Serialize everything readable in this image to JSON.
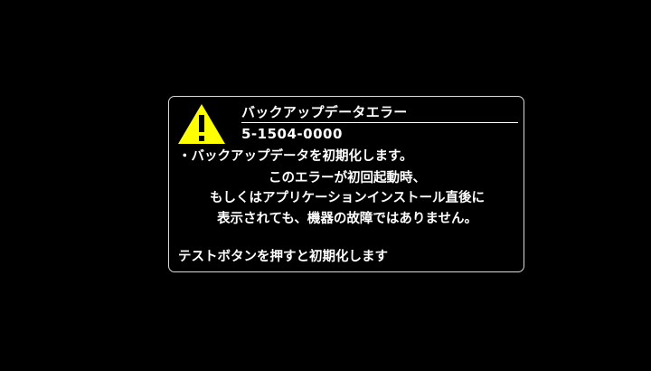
{
  "dialog": {
    "title": "バックアップデータエラー",
    "error_code": "5-1504-0000",
    "message_lines": [
      "・バックアップデータを初期化します。",
      "このエラーが初回起動時、",
      "もしくはアプリケーションインストール直後に",
      "表示されても、機器の故障ではありません。"
    ],
    "instruction": "テストボタンを押すと初期化します",
    "icon": "warning-triangle-icon",
    "colors": {
      "background": "#000000",
      "text": "#ffffff",
      "border": "#d8d8d8",
      "warning_fill": "#ffff00",
      "warning_glyph": "#000000"
    }
  }
}
